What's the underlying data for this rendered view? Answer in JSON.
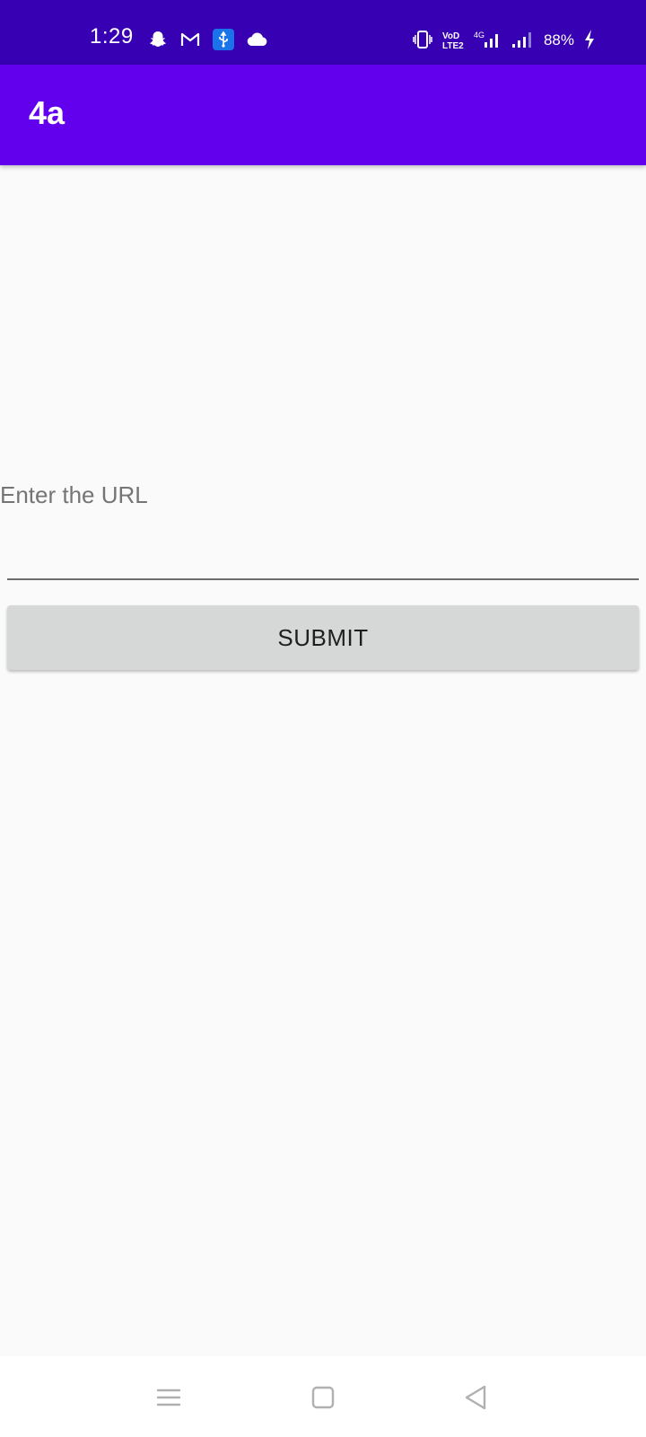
{
  "status_bar": {
    "time": "1:29",
    "battery": "88%",
    "network": "4G",
    "notification_icons": [
      "snapchat-icon",
      "gmail-icon",
      "usb-icon",
      "cloud-icon"
    ],
    "system_icons": [
      "vibrate-icon",
      "volte-icon",
      "signal-icon",
      "signal-icon",
      "charging-icon"
    ]
  },
  "app_bar": {
    "title": "4a",
    "color": "#6200ee"
  },
  "form": {
    "url_placeholder": "Enter the URL",
    "url_value": "",
    "submit_label": "SUBMIT"
  },
  "nav_bar": {
    "buttons": [
      "menu-icon",
      "home-icon",
      "back-icon"
    ]
  },
  "colors": {
    "status_bar": "#3700b3",
    "app_bar": "#6200ee",
    "background": "#fafafa",
    "button": "#d6d7d7"
  }
}
